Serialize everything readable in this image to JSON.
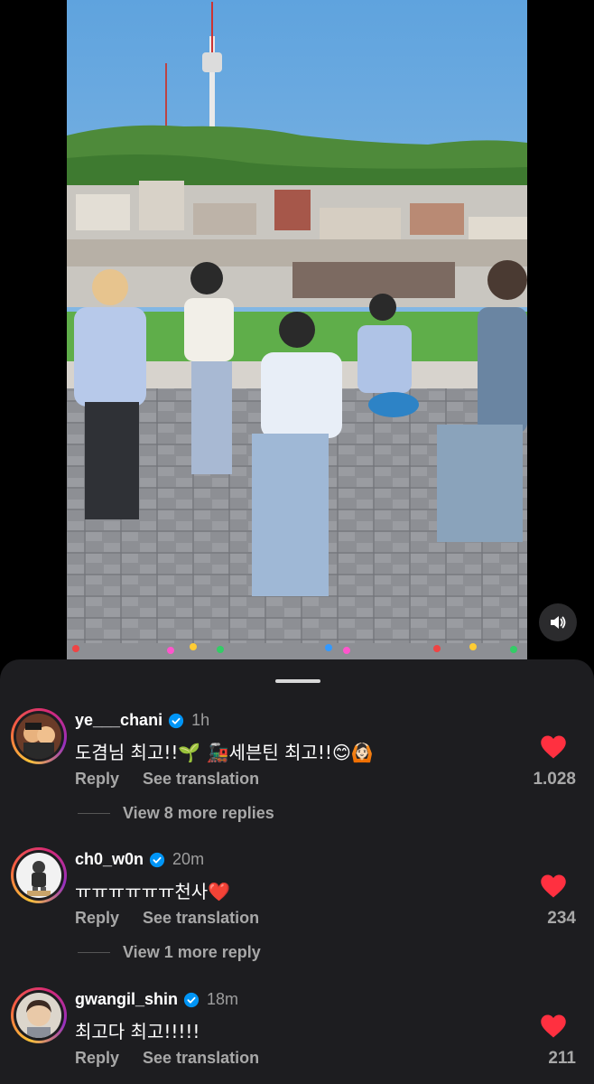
{
  "video": {
    "sound_icon": "speaker-icon"
  },
  "comments": [
    {
      "username": "ye___chani",
      "verified": true,
      "time": "1h",
      "text": "도겸님 최고!!🌱 🚂세븐틴 최고!!😊🙆🏻",
      "reply_label": "Reply",
      "translate_label": "See translation",
      "likes": "1.028",
      "liked": true,
      "more_replies": "View 8 more replies"
    },
    {
      "username": "ch0_w0n",
      "verified": true,
      "time": "20m",
      "text": "ㅠㅠㅠㅠㅠㅠ천사❤️",
      "reply_label": "Reply",
      "translate_label": "See translation",
      "likes": "234",
      "liked": true,
      "more_replies": "View 1 more reply"
    },
    {
      "username": "gwangil_shin",
      "verified": true,
      "time": "18m",
      "text": "최고다 최고!!!!!",
      "reply_label": "Reply",
      "translate_label": "See translation",
      "likes": "211",
      "liked": true
    }
  ],
  "colors": {
    "heart": "#ff3040",
    "verified": "#0095f6",
    "sheet": "#1d1d20"
  }
}
